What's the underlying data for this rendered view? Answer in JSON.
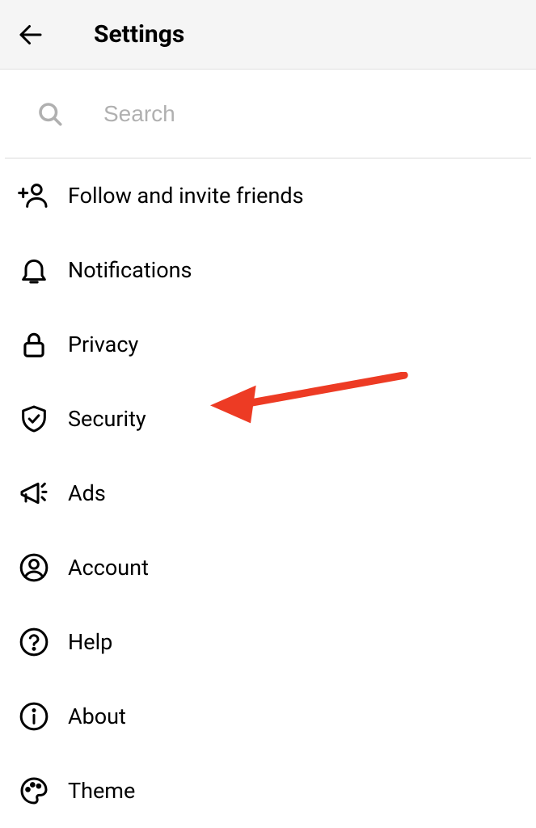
{
  "header": {
    "title": "Settings"
  },
  "search": {
    "placeholder": "Search",
    "value": ""
  },
  "menu": {
    "items": [
      {
        "label": "Follow and invite friends",
        "icon": "add-user-icon"
      },
      {
        "label": "Notifications",
        "icon": "bell-icon"
      },
      {
        "label": "Privacy",
        "icon": "lock-icon"
      },
      {
        "label": "Security",
        "icon": "shield-check-icon"
      },
      {
        "label": "Ads",
        "icon": "megaphone-icon"
      },
      {
        "label": "Account",
        "icon": "user-circle-icon"
      },
      {
        "label": "Help",
        "icon": "question-circle-icon"
      },
      {
        "label": "About",
        "icon": "info-circle-icon"
      },
      {
        "label": "Theme",
        "icon": "palette-icon"
      }
    ]
  },
  "annotation": {
    "arrow_color": "#ed3b24",
    "points_to": "Security"
  }
}
